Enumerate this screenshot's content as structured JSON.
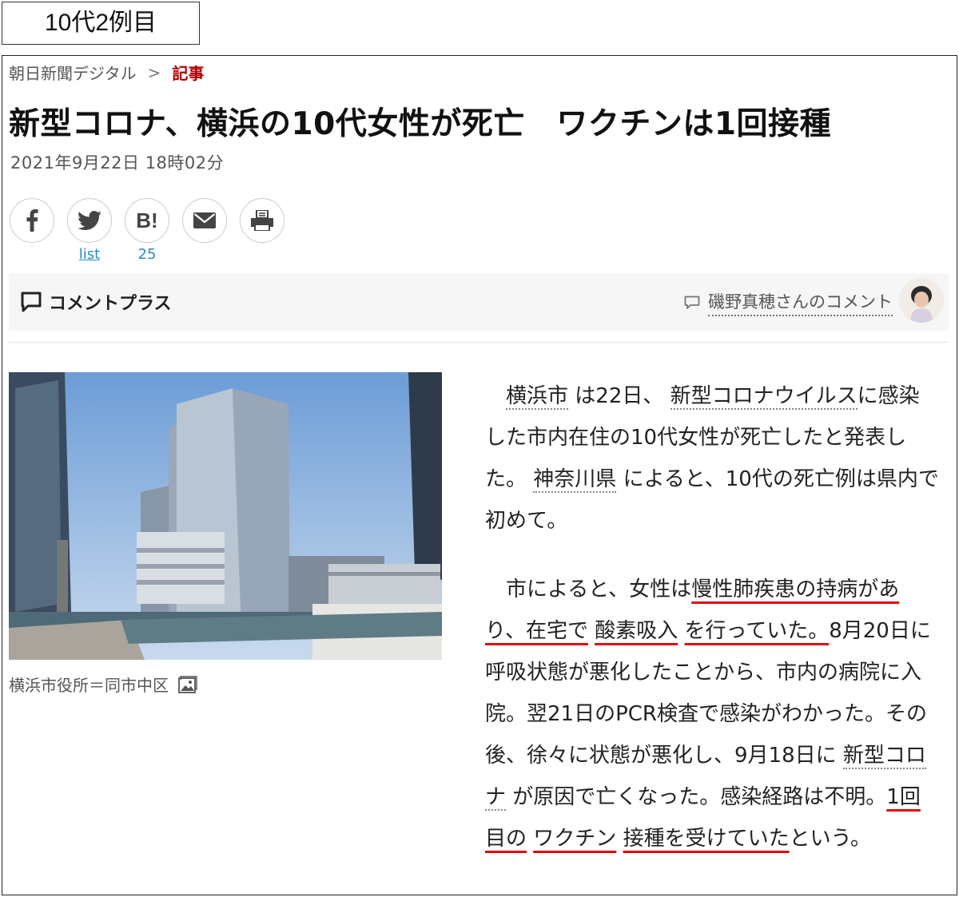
{
  "tag_label": "10代2例目",
  "breadcrumb": {
    "site": "朝日新聞デジタル",
    "separator": ">",
    "current": "記事"
  },
  "headline": "新型コロナ、横浜の10代女性が死亡　ワクチンは1回接種",
  "dateline": "2021年9月22日 18時02分",
  "share": {
    "buttons": [
      {
        "icon": "facebook-icon"
      },
      {
        "icon": "twitter-icon",
        "count": "list"
      },
      {
        "icon": "hatena-bookmark-icon",
        "label": "B!",
        "count": "25"
      },
      {
        "icon": "mail-icon"
      },
      {
        "icon": "print-icon"
      }
    ]
  },
  "comment_plus": {
    "title": "コメントプラス",
    "commenter_link": "磯野真穂さんのコメント"
  },
  "photo": {
    "caption": "横浜市役所＝同市中区"
  },
  "article": {
    "p1": {
      "kw_city": "横浜市",
      "t1": "は22日、",
      "kw_virus": "新型コロナウイルス",
      "t2": "に感染した市内在住の10代女性が死亡したと発表した。",
      "kw_pref": "神奈川県",
      "t3": "によると、10代の死亡例は県内で初めて。"
    },
    "p2": {
      "t1": "市によると、女性は",
      "hl1": "慢性肺疾患の持病があり、在宅で",
      "kw_oxygen": "酸素吸入",
      "hl2": "を行っていた。",
      "t2": "8月20日に呼吸状態が悪化したことから、市内の病院に入院。翌21日のPCR検査で感染がわかった。その後、徐々に状態が悪化し、9月18日に",
      "kw_corona": "新型コロナ",
      "t3": "が原因で亡くなった。感染経路は不明。",
      "hl3": "1回目の",
      "kw_vaccine": "ワクチン",
      "hl4": "接種を受けていた",
      "t4": "という。"
    }
  },
  "colors": {
    "highlight": "#e30613",
    "breadcrumb_current": "#b10000",
    "count_link": "#2a8bc7"
  }
}
